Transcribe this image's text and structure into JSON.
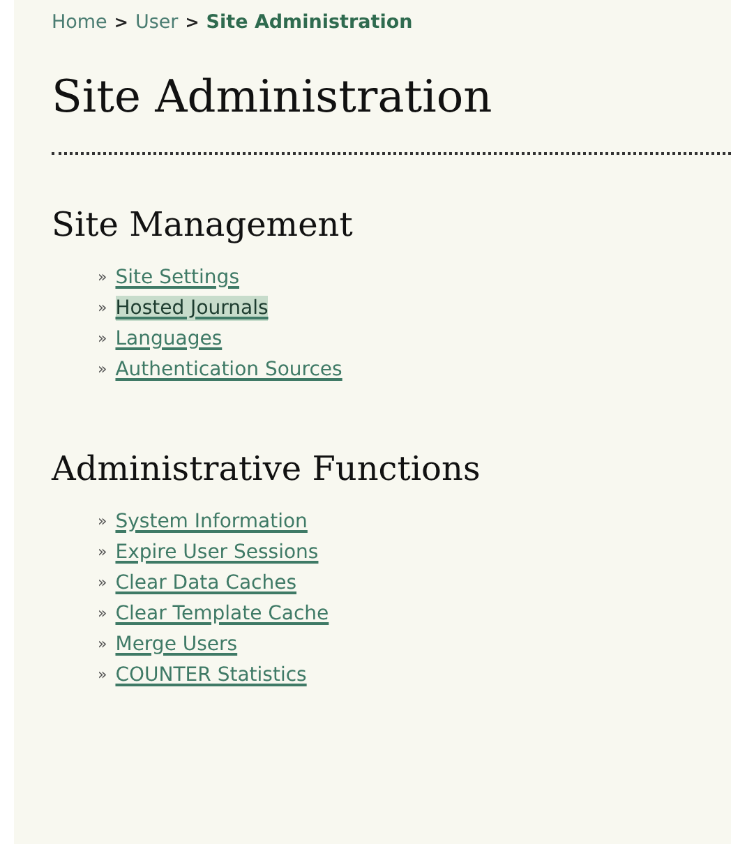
{
  "breadcrumb": [
    {
      "kind": "link",
      "text": "Home"
    },
    {
      "kind": "separator",
      "text": ">"
    },
    {
      "kind": "link",
      "text": "User"
    },
    {
      "kind": "separator",
      "text": ">"
    },
    {
      "kind": "current",
      "text": "Site Administration"
    }
  ],
  "page_title": "Site Administration",
  "sections": [
    {
      "title": "Site Management",
      "links": [
        {
          "marker": "»",
          "label": "Site Settings",
          "highlighted": false
        },
        {
          "marker": "»",
          "label": "Hosted Journals",
          "highlighted": true
        },
        {
          "marker": "»",
          "label": "Languages",
          "highlighted": false
        },
        {
          "marker": "»",
          "label": "Authentication Sources",
          "highlighted": false
        }
      ]
    },
    {
      "title": "Administrative Functions",
      "links": [
        {
          "marker": "»",
          "label": "System Information",
          "highlighted": false
        },
        {
          "marker": "»",
          "label": "Expire User Sessions",
          "highlighted": false
        },
        {
          "marker": "»",
          "label": "Clear Data Caches",
          "highlighted": false
        },
        {
          "marker": "»",
          "label": "Clear Template Cache",
          "highlighted": false
        },
        {
          "marker": "»",
          "label": "Merge Users",
          "highlighted": false
        },
        {
          "marker": "»",
          "label": "COUNTER Statistics",
          "highlighted": false
        }
      ]
    }
  ]
}
